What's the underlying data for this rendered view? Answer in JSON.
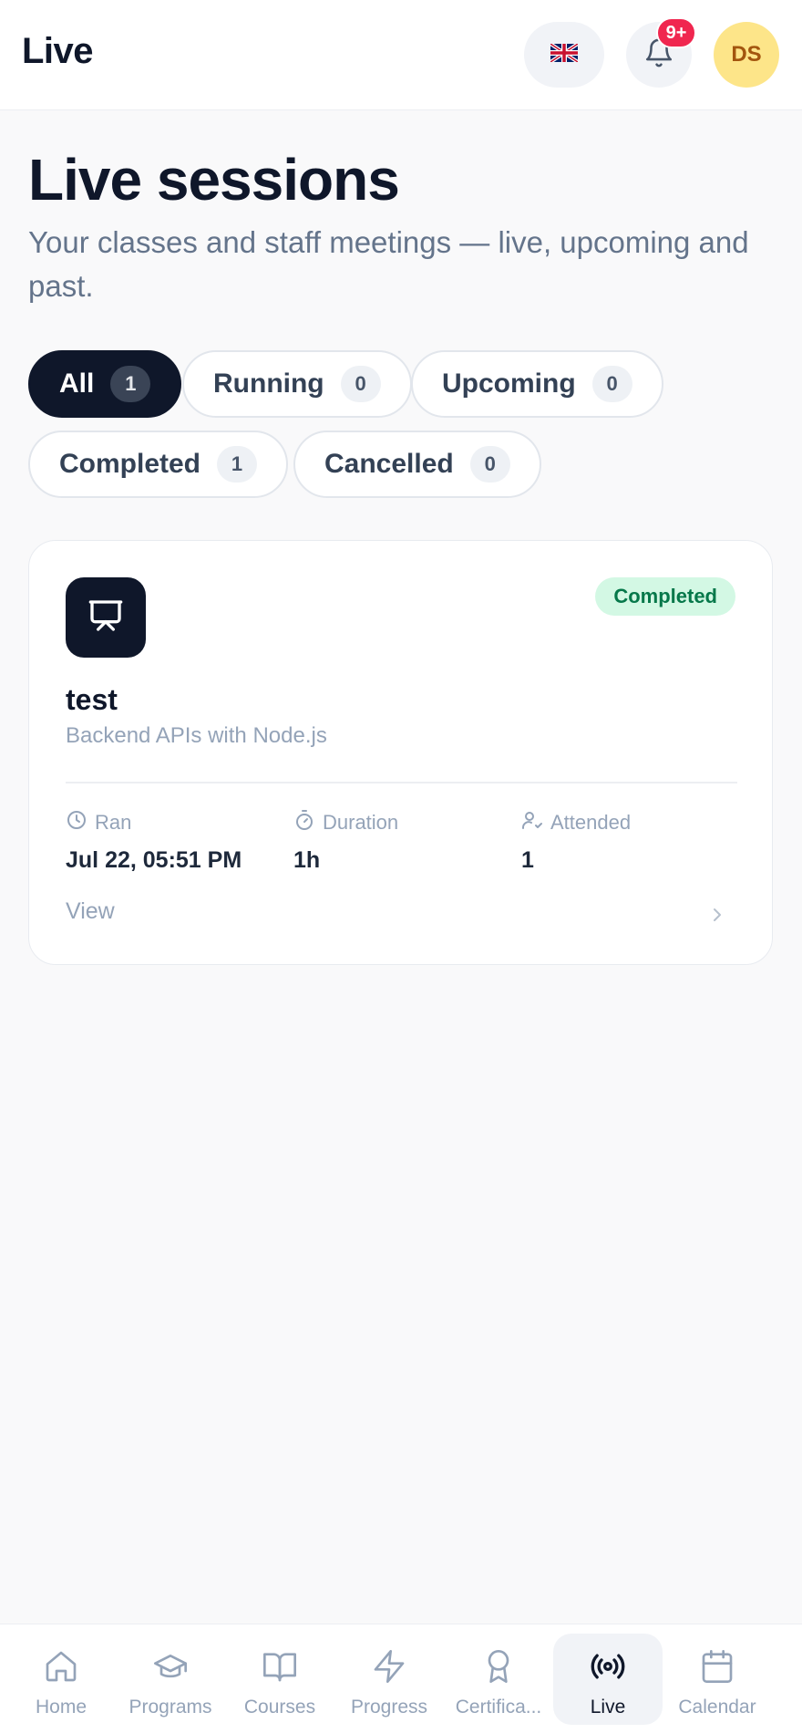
{
  "header": {
    "title": "Live",
    "language_flag": "🇬🇧",
    "notifications_badge": "9+",
    "avatar_initials": "DS"
  },
  "page": {
    "title": "Live sessions",
    "subtitle": "Your classes and staff meetings — live, upcoming and past."
  },
  "filters": [
    {
      "label": "All",
      "count": "1",
      "active": true
    },
    {
      "label": "Running",
      "count": "0",
      "active": false
    },
    {
      "label": "Upcoming",
      "count": "0",
      "active": false
    },
    {
      "label": "Completed",
      "count": "1",
      "active": false
    },
    {
      "label": "Cancelled",
      "count": "0",
      "active": false
    }
  ],
  "session": {
    "status": "Completed",
    "title": "test",
    "subtitle": "Backend APIs with Node.js",
    "meta": [
      {
        "label": "Ran",
        "value": "Jul 22, 05:51 PM",
        "icon": "clock-icon"
      },
      {
        "label": "Duration",
        "value": "1h",
        "icon": "timer-icon"
      },
      {
        "label": "Attended",
        "value": "1",
        "icon": "user-check-icon"
      }
    ],
    "view_label": "View"
  },
  "nav": [
    {
      "label": "Home",
      "icon": "home-icon",
      "active": false
    },
    {
      "label": "Programs",
      "icon": "graduation-cap-icon",
      "active": false
    },
    {
      "label": "Courses",
      "icon": "book-open-icon",
      "active": false
    },
    {
      "label": "Progress",
      "icon": "zap-icon",
      "active": false
    },
    {
      "label": "Certifica...",
      "icon": "award-icon",
      "active": false
    },
    {
      "label": "Live",
      "icon": "broadcast-icon",
      "active": true
    },
    {
      "label": "Calendar",
      "icon": "calendar-icon",
      "active": false
    }
  ],
  "colors": {
    "primary": "#0f172a",
    "badge_red": "#f0264f",
    "status_green_bg": "#d3f8e4",
    "status_green_text": "#06784a",
    "avatar_bg": "#fde589"
  }
}
